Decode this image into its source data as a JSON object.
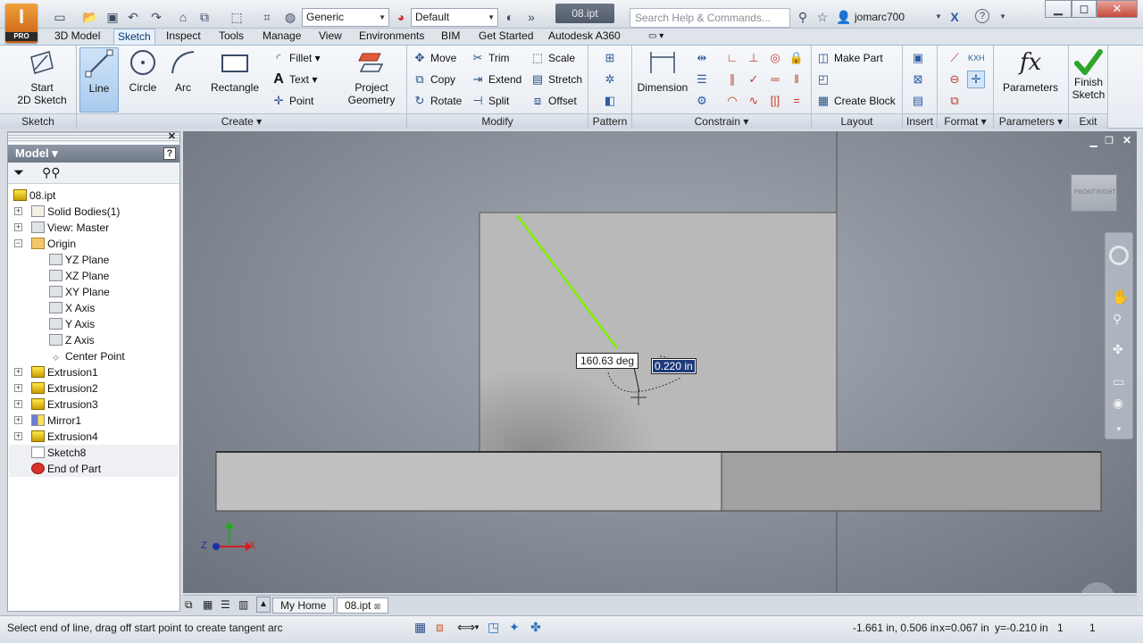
{
  "app": {
    "logo_letter": "I",
    "edition": "PRO",
    "document_title": "08.ipt"
  },
  "qat": {
    "material": "Generic",
    "appearance": "Default",
    "search_placeholder": "Search Help & Commands...",
    "user": "jomarc700"
  },
  "tabs": [
    "3D Model",
    "Sketch",
    "Inspect",
    "Tools",
    "Manage",
    "View",
    "Environments",
    "BIM",
    "Get Started",
    "Autodesk A360"
  ],
  "active_tab": "Sketch",
  "ribbon": {
    "sketch": {
      "start_line1": "Start",
      "start_line2": "2D Sketch",
      "panel": "Sketch"
    },
    "create": {
      "line": "Line",
      "circle": "Circle",
      "arc": "Arc",
      "rectangle": "Rectangle",
      "fillet": "Fillet",
      "text": "Text",
      "point": "Point",
      "project_line1": "Project",
      "project_line2": "Geometry",
      "panel": "Create"
    },
    "modify": {
      "move": "Move",
      "trim": "Trim",
      "scale": "Scale",
      "copy": "Copy",
      "extend": "Extend",
      "stretch": "Stretch",
      "rotate": "Rotate",
      "split": "Split",
      "offset": "Offset",
      "panel": "Modify"
    },
    "pattern": {
      "panel": "Pattern"
    },
    "constrain": {
      "dimension": "Dimension",
      "panel": "Constrain"
    },
    "layout": {
      "make_part": "Make Part",
      "create_block": "Create Block",
      "panel": "Layout"
    },
    "insert": {
      "panel": "Insert"
    },
    "format": {
      "panel": "Format"
    },
    "parameters": {
      "label": "Parameters",
      "panel": "Parameters"
    },
    "exit": {
      "finish_line1": "Finish",
      "finish_line2": "Sketch",
      "panel": "Exit"
    }
  },
  "browser": {
    "title": "Model",
    "items": [
      {
        "label": "08.ipt"
      },
      {
        "label": "Solid Bodies(1)"
      },
      {
        "label": "View: Master"
      },
      {
        "label": "Origin"
      },
      {
        "label": "YZ Plane"
      },
      {
        "label": "XZ Plane"
      },
      {
        "label": "XY Plane"
      },
      {
        "label": "X Axis"
      },
      {
        "label": "Y Axis"
      },
      {
        "label": "Z Axis"
      },
      {
        "label": "Center Point"
      },
      {
        "label": "Extrusion1"
      },
      {
        "label": "Extrusion2"
      },
      {
        "label": "Extrusion3"
      },
      {
        "label": "Mirror1"
      },
      {
        "label": "Extrusion4"
      },
      {
        "label": "Sketch8"
      },
      {
        "label": "End of Part"
      }
    ]
  },
  "viewport": {
    "angle_dim": "160.63 deg",
    "length_dim": "0.220 in",
    "viewcube_front": "FRONT",
    "viewcube_right": "RIGHT",
    "axis_z": "Z",
    "axis_x": "X"
  },
  "doc_tabs": [
    "My Home",
    "08.ipt"
  ],
  "status": {
    "prompt": "Select end of line, drag off start point to create tangent arc",
    "coords": "-1.661 in, 0.506 in",
    "x": "x=0.067 in",
    "y": "y=-0.210 in",
    "count1": "1",
    "count2": "1"
  },
  "colors": {
    "accent": "#1e3a7a",
    "sketch_line": "#7ff000",
    "face": "#b8b8b8"
  }
}
